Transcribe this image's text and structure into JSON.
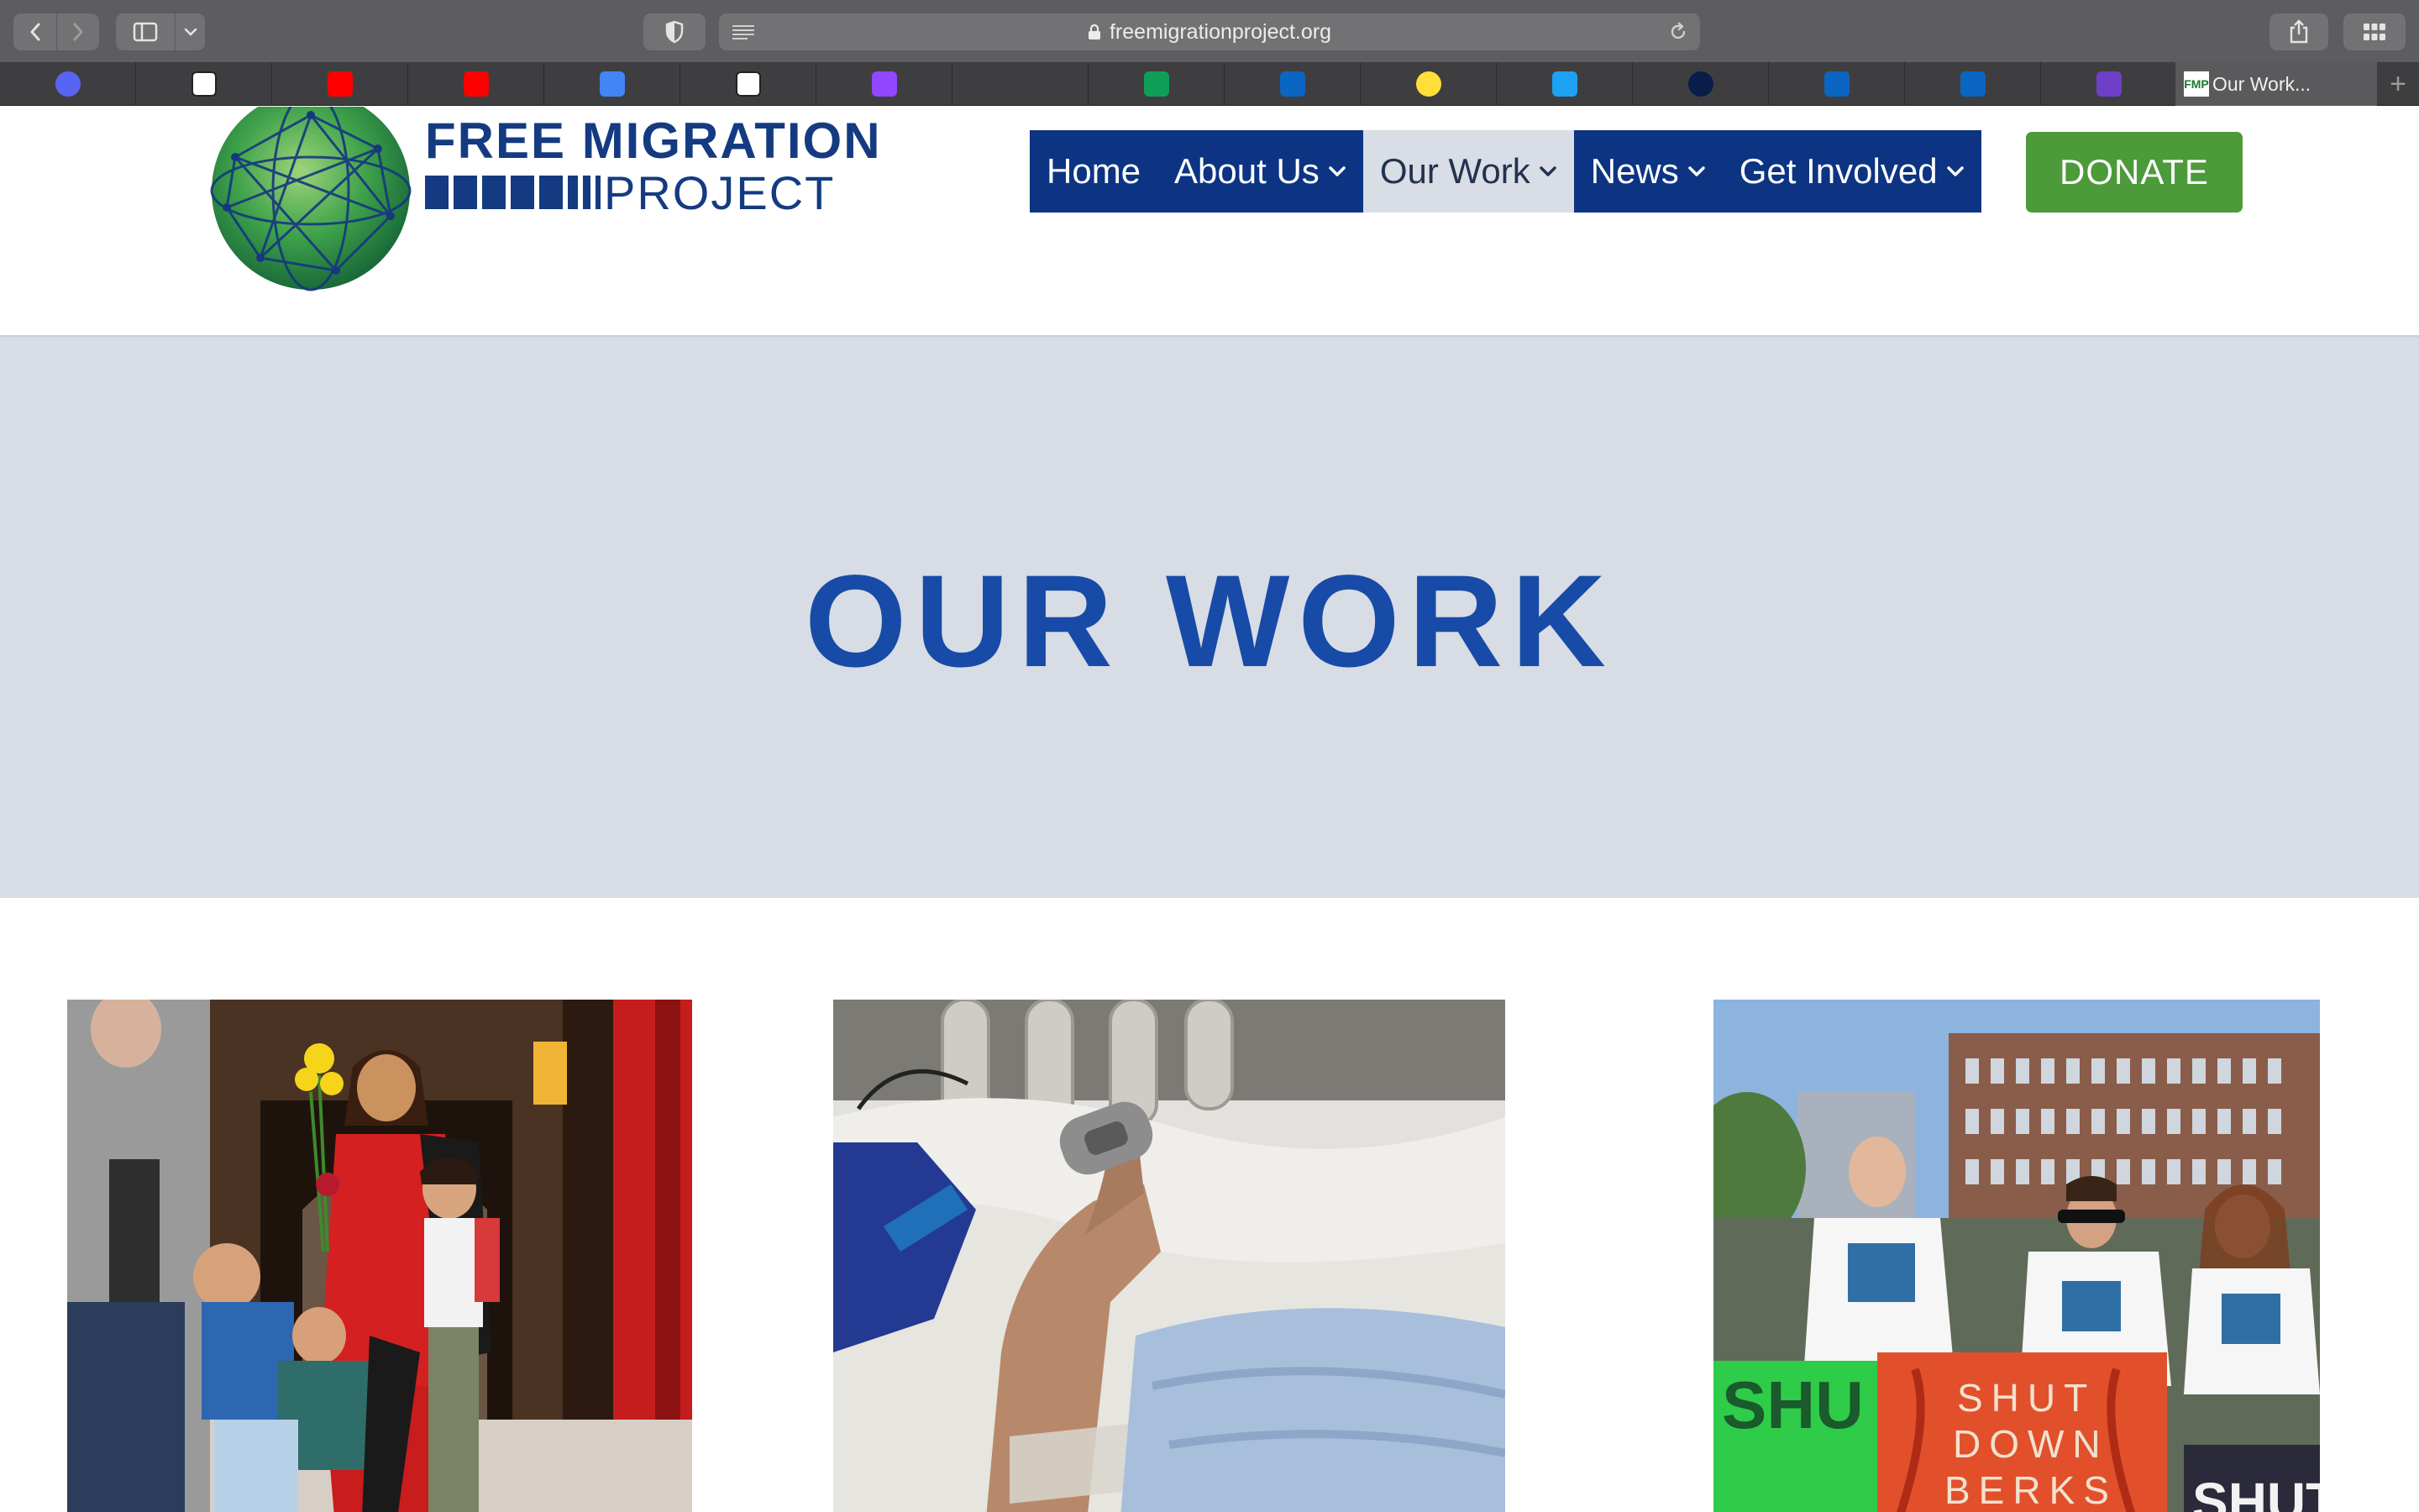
{
  "browser": {
    "url": "freemigrationproject.org",
    "favorites": [
      {
        "icon": "discord-icon",
        "color": "#5865f2"
      },
      {
        "icon": "dg-icon",
        "color": "#ffffff"
      },
      {
        "icon": "youtube-icon",
        "color": "#ff0000"
      },
      {
        "icon": "youtube-icon",
        "color": "#ff0000"
      },
      {
        "icon": "google-docs-icon",
        "color": "#4285f4"
      },
      {
        "icon": "notion-icon",
        "color": "#ffffff"
      },
      {
        "icon": "twitch-icon",
        "color": "#9146ff"
      },
      {
        "icon": "empty",
        "color": ""
      },
      {
        "icon": "google-sheets-icon",
        "color": "#0f9d58"
      },
      {
        "icon": "linkedin-icon",
        "color": "#0a66c2"
      },
      {
        "icon": "otta-icon",
        "color": "#ffe03a"
      },
      {
        "icon": "bird-icon",
        "color": "#1da1f2"
      },
      {
        "icon": "b-icon",
        "color": "#0a1e4a"
      },
      {
        "icon": "linkedin-icon",
        "color": "#0a66c2"
      },
      {
        "icon": "linkedin-icon",
        "color": "#0a66c2"
      },
      {
        "icon": "mail-icon",
        "color": "#6f3fc9"
      }
    ],
    "active_tab": {
      "favicon_text": "FMP",
      "title": "Our Work..."
    }
  },
  "site": {
    "logo": {
      "line1": "FREE MIGRATION",
      "line2": "PROJECT"
    },
    "nav": [
      {
        "label": "Home",
        "dropdown": false,
        "active": false
      },
      {
        "label": "About Us",
        "dropdown": true,
        "active": false
      },
      {
        "label": "Our Work",
        "dropdown": true,
        "active": true
      },
      {
        "label": "News",
        "dropdown": true,
        "active": false
      },
      {
        "label": "Get Involved",
        "dropdown": true,
        "active": false
      }
    ],
    "donate_label": "DONATE",
    "hero_title": "OUR WORK",
    "photos": {
      "photo_3_sign_left": "SHU DOW",
      "photo_3_sign_center": [
        "SHUT",
        "DOWN",
        "BERKS"
      ],
      "photo_3_sign_right": "SHUT"
    }
  },
  "colors": {
    "nav_bg": "#0d3483",
    "nav_active_bg": "#d8dde6",
    "donate": "#4c9a3a",
    "hero_bg": "#d7dce5",
    "hero_title": "#174ba7"
  }
}
